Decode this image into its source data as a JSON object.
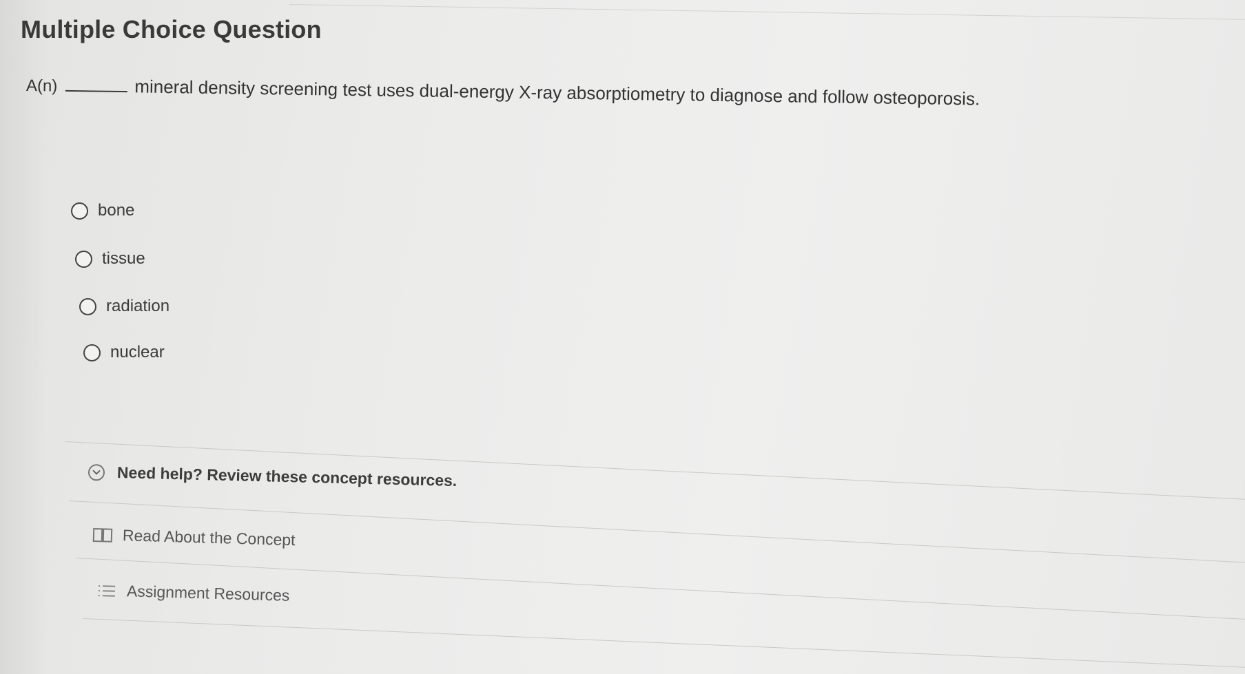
{
  "question": {
    "title": "Multiple Choice Question",
    "prompt_prefix": "A(n)",
    "prompt_text": "mineral density screening test uses dual-energy X-ray absorptiometry to diagnose and follow osteoporosis."
  },
  "options": [
    {
      "label": "bone"
    },
    {
      "label": "tissue"
    },
    {
      "label": "radiation"
    },
    {
      "label": "nuclear"
    }
  ],
  "help": {
    "text": "Need help? Review these concept resources.",
    "icon": "chevron-down-circle-icon"
  },
  "resources": [
    {
      "label": "Read About the Concept",
      "icon": "book-icon"
    },
    {
      "label": "Assignment Resources",
      "icon": "list-icon"
    }
  ]
}
